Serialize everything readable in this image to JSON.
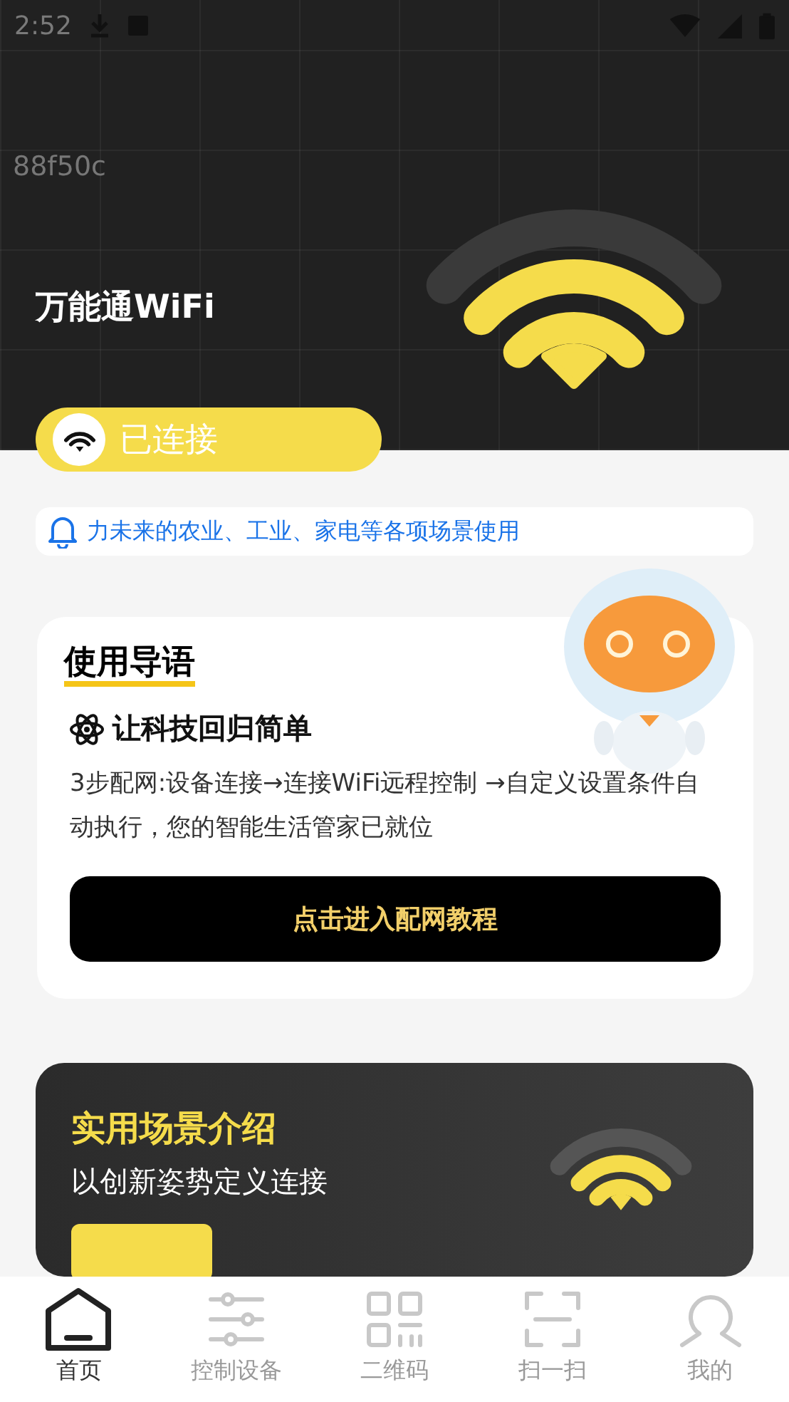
{
  "status_bar": {
    "time": "2:52"
  },
  "header": {
    "code": "88f50c",
    "title": "万能通WiFi"
  },
  "connection": {
    "label": "已连接"
  },
  "notice": {
    "text": "力未来的农业、工业、家电等各项场景使用"
  },
  "guide_card": {
    "title": "使用导语",
    "subtitle": "让科技回归简单",
    "description": "3步配网:设备连接→连接WiFi远程控制 →自定义设置条件自动执行，您的智能生活管家已就位",
    "button": "点击进入配网教程"
  },
  "scene_banner": {
    "title": "实用场景介绍",
    "subtitle": "以创新姿势定义连接"
  },
  "nav": [
    {
      "label": "首页",
      "selected": true
    },
    {
      "label": "控制设备",
      "selected": false
    },
    {
      "label": "二维码",
      "selected": false
    },
    {
      "label": "扫一扫",
      "selected": false
    },
    {
      "label": "我的",
      "selected": false
    }
  ]
}
